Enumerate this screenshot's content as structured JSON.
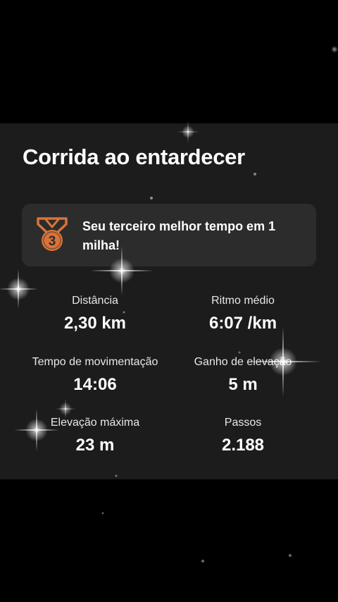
{
  "activity": {
    "title": "Corrida ao entardecer"
  },
  "achievement": {
    "icon": "bronze-medal-icon",
    "rank": "3",
    "text": "Seu terceiro melhor tempo em 1 milha!",
    "medal_color": "#d9733a"
  },
  "stats": [
    {
      "label": "Distância",
      "value": "2,30 km"
    },
    {
      "label": "Ritmo médio",
      "value": "6:07 /km"
    },
    {
      "label": "Tempo de movimentação",
      "value": "14:06"
    },
    {
      "label": "Ganho de elevação",
      "value": "5 m"
    },
    {
      "label": "Elevação máxima",
      "value": "23 m"
    },
    {
      "label": "Passos",
      "value": "2.188"
    }
  ],
  "colors": {
    "background": "#000000",
    "card": "#1c1c1c",
    "achievement_bg": "#2c2c2c"
  }
}
